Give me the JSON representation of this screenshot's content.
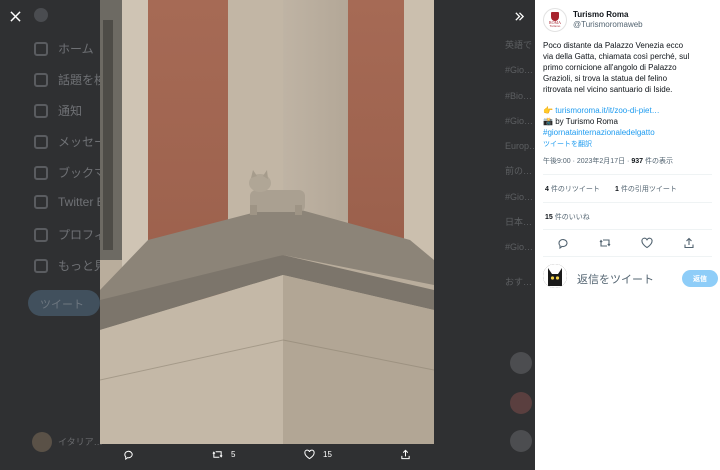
{
  "background": {
    "nav_items": [
      "ホーム",
      "話題を検索",
      "通知",
      "メッセージ",
      "ブックマーク",
      "Twitter Blue",
      "プロフィール",
      "もっと見る"
    ],
    "tweet_button": "ツイート",
    "user_name": "イタリア…",
    "right_column": [
      "英語で",
      "#Gio…",
      "#Bio…",
      "#Gio…",
      "Europ…",
      "前の…",
      "#Gio…",
      "日本…",
      "#Gio…",
      "おす…"
    ]
  },
  "overlay": {
    "close_icon": "close-icon",
    "expand_icon": "expand-icon"
  },
  "photo_actions": {
    "reply_icon": "reply-icon",
    "retweet_count": "5",
    "like_count": "15",
    "share_icon": "share-icon"
  },
  "tweet": {
    "author_name": "Turismo Roma",
    "author_handle": "@Turismoromaweb",
    "logo_text": "ROMA",
    "logo_subtext": "Turismo",
    "body_lines": [
      "Poco distante da Palazzo Venezia ecco",
      "via della Gatta, chiamata così perché, sul",
      "primo cornicione all'angolo di Palazzo",
      "Grazioli, si trova la statua del felino",
      "ritrovata nel vicino santuario di Iside."
    ],
    "link_emoji": "👉",
    "link_text": "turismoroma.it/it/zoo-di-piet…",
    "credit_emoji": "📸",
    "credit_text": "by Turismo Roma",
    "hashtag": "#giornatainternazionaledelgatto",
    "translate_label": "ツイートを翻訳",
    "timestamp": "午後9:00 · 2023年2月17日 · ",
    "views_count": "937",
    "views_label": " 件の表示",
    "retweets_count": "4",
    "retweets_label": " 件のリツイート",
    "quotes_count": "1",
    "quotes_label": " 件の引用ツイート",
    "likes_count": "15",
    "likes_label": " 件のいいね"
  },
  "reply": {
    "placeholder": "返信をツイート",
    "button_label": "返信"
  },
  "colors": {
    "accent": "#1d9bf0",
    "reply_button": "#8ecdf8",
    "dim_background": "#2f3032"
  }
}
